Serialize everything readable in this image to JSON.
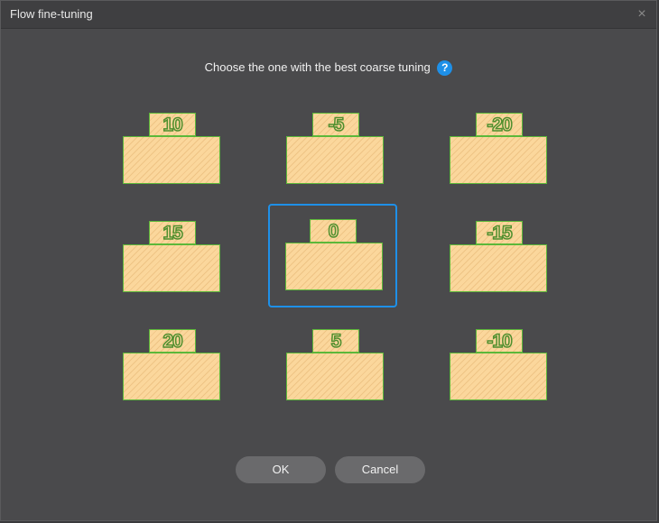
{
  "window": {
    "title": "Flow fine-tuning",
    "close_glyph": "×"
  },
  "prompt": {
    "text": "Choose the one with the best coarse tuning",
    "help_glyph": "?"
  },
  "options": [
    {
      "label": "10",
      "selected": false
    },
    {
      "label": "-5",
      "selected": false
    },
    {
      "label": "-20",
      "selected": false
    },
    {
      "label": "15",
      "selected": false
    },
    {
      "label": "0",
      "selected": true
    },
    {
      "label": "-15",
      "selected": false
    },
    {
      "label": "20",
      "selected": false
    },
    {
      "label": "5",
      "selected": false
    },
    {
      "label": "-10",
      "selected": false
    }
  ],
  "buttons": {
    "ok": "OK",
    "cancel": "Cancel"
  },
  "colors": {
    "accent": "#1e90e8",
    "sample_fill": "#fbd79c",
    "sample_outline": "#5cb83a",
    "dialog_bg": "#4a4a4c"
  }
}
